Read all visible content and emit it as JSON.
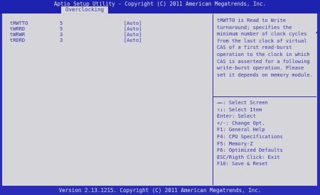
{
  "header": {
    "title": "Aptio Setup Utility - Copyright (C) 2011 American Megatrends, Inc.",
    "tab": "Overclocking"
  },
  "settings": [
    {
      "name": "tRWTTO",
      "value": "5",
      "option": "[Auto]"
    },
    {
      "name": "tWRRD",
      "value": "5",
      "option": "[Auto]"
    },
    {
      "name": "tWRWR",
      "value": "3",
      "option": "[Auto]"
    },
    {
      "name": "tRDRD",
      "value": "3",
      "option": "[Auto]"
    }
  ],
  "help": {
    "text": "tRWTTO is Read to Write turnaround; specifies the minimum number of clock cycles from the last clock of virtual CAS of a first read-burst operation to the clock in which CAS is asserted for a following write-burst operation. Please set it depends on memory module."
  },
  "keys": [
    "→←: Select Screen",
    "↑↓: Select Item",
    "Enter: Select",
    "+/-: Change Opt.",
    "F1: General Help",
    "F4: CPU Specifications",
    "F5: Memory-Z",
    "F6: Optimized Defaults",
    "ESC/Rigth Click: Exit",
    "F10: Save & Reset"
  ],
  "footer": {
    "text": "Version 2.13.1215. Copyright (C) 2011 American Megatrends, Inc."
  },
  "colors": {
    "background": "#2a2db8",
    "panel": "#d6d6da",
    "text": "#2d30b4"
  }
}
